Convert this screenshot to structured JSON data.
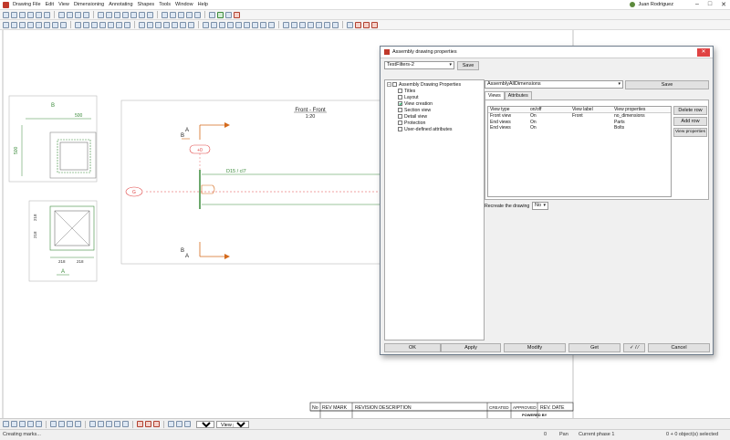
{
  "menu": [
    "Drawing File",
    "Edit",
    "View",
    "Dimensioning",
    "Annotating",
    "Shapes",
    "Tools",
    "Window",
    "Help"
  ],
  "user": "Juan Rodriguez",
  "window_buttons": [
    "–",
    "□",
    "✕"
  ],
  "drawing": {
    "view_title": "Front - Front",
    "view_scale": "1:20",
    "section_b": "B",
    "section_a": "A",
    "dim_500_top": "500",
    "dim_500_left": "500",
    "dim_218_a": "218",
    "dim_218_b": "218",
    "dim_218_c": "218",
    "dim_218_d": "218",
    "level_mark": "+0",
    "label_g": "G",
    "profile_label": "D15 / cl7",
    "revision_headers": [
      "No",
      "REV MARK",
      "REVISION DESCRIPTION",
      "CREATED",
      "APPROVED",
      "REV. DATE"
    ],
    "powered_by": "POWERED BY"
  },
  "dialog": {
    "title": "Assembly drawing properties",
    "preset": "TestFilters-2",
    "save_top": "Save",
    "attr_file": "AssemblyAllDimensions",
    "save_right": "Save",
    "tree": {
      "root": "Assembly Drawing Properties",
      "items": [
        {
          "label": "Titles",
          "checked": false
        },
        {
          "label": "Layout",
          "checked": false
        },
        {
          "label": "View creation",
          "checked": true
        },
        {
          "label": "Section view",
          "checked": false
        },
        {
          "label": "Detail view",
          "checked": false
        },
        {
          "label": "Protection",
          "checked": false
        },
        {
          "label": "User-defined attributes",
          "checked": false
        }
      ]
    },
    "tabs": [
      "Views",
      "Attributes"
    ],
    "grid": {
      "headers": [
        "View type",
        "on/off",
        "View label",
        "View properties"
      ],
      "rows": [
        [
          "Front view",
          "On",
          "Front",
          "no_dimensions"
        ],
        [
          "End views",
          "On",
          "",
          "Parts"
        ],
        [
          "End views",
          "On",
          "",
          "Bolts"
        ]
      ]
    },
    "side_buttons": [
      "Delete row",
      "Add row",
      "View properties"
    ],
    "recreate_label": "Recreate the drawing",
    "recreate_value": "No",
    "footer": {
      "ok": "OK",
      "apply": "Apply",
      "modify": "Modify",
      "get": "Get",
      "toggle": "✓ / ⁄",
      "cancel": "Cancel"
    }
  },
  "bottombar": {
    "zoom": "Auto",
    "plane": "View plane"
  },
  "status": {
    "left": "Creating marks...",
    "count": "0",
    "mode": "Pan",
    "phase": "Current phase 1",
    "selected": "0 + 0 object(s) selected"
  },
  "colors": {
    "accent": "#d46a1c",
    "dim": "#3a8a3a",
    "titlered": "#e04343"
  }
}
